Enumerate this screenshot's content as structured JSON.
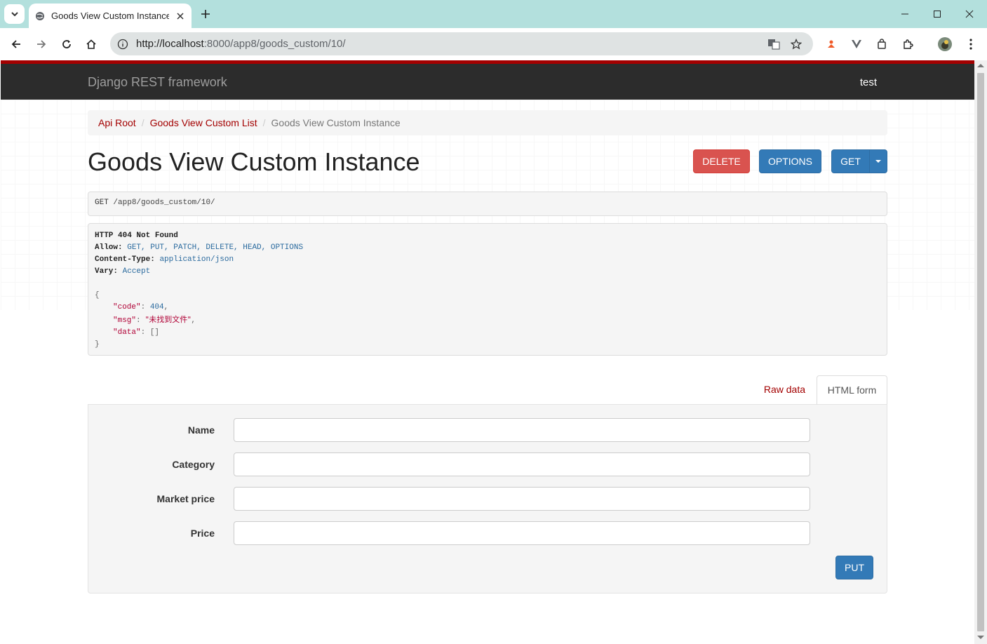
{
  "browser": {
    "tab_title": "Goods View Custom Instance",
    "url_host": "http://localhost",
    "url_rest": ":8000/app8/goods_custom/10/"
  },
  "navbar": {
    "brand": "Django REST framework",
    "user": "test"
  },
  "breadcrumb": {
    "items": [
      "Api Root",
      "Goods View Custom List"
    ],
    "active": "Goods View Custom Instance",
    "separator": "/"
  },
  "page": {
    "title": "Goods View Custom Instance",
    "delete_label": "DELETE",
    "options_label": "OPTIONS",
    "get_label": "GET"
  },
  "request": {
    "method": "GET",
    "path": "/app8/goods_custom/10/"
  },
  "response": {
    "status": "HTTP 404 Not Found",
    "allow_label": "Allow:",
    "allow_value": "GET, PUT, PATCH, DELETE, HEAD, OPTIONS",
    "ctype_label": "Content-Type:",
    "ctype_value": "application/json",
    "vary_label": "Vary:",
    "vary_value": "Accept",
    "open_brace": "{",
    "close_brace": "}",
    "code_key": "\"code\"",
    "code_value": "404",
    "msg_key": "\"msg\"",
    "msg_value": "\"未找到文件\"",
    "data_key": "\"data\"",
    "data_value": "[]"
  },
  "form": {
    "raw_tab": "Raw data",
    "html_tab": "HTML form",
    "fields": [
      "Name",
      "Category",
      "Market price",
      "Price"
    ],
    "submit_label": "PUT"
  },
  "colors": {
    "accent": "#a30000",
    "primary": "#337ab7",
    "danger": "#d9534f",
    "navbar": "#2c2c2c"
  }
}
